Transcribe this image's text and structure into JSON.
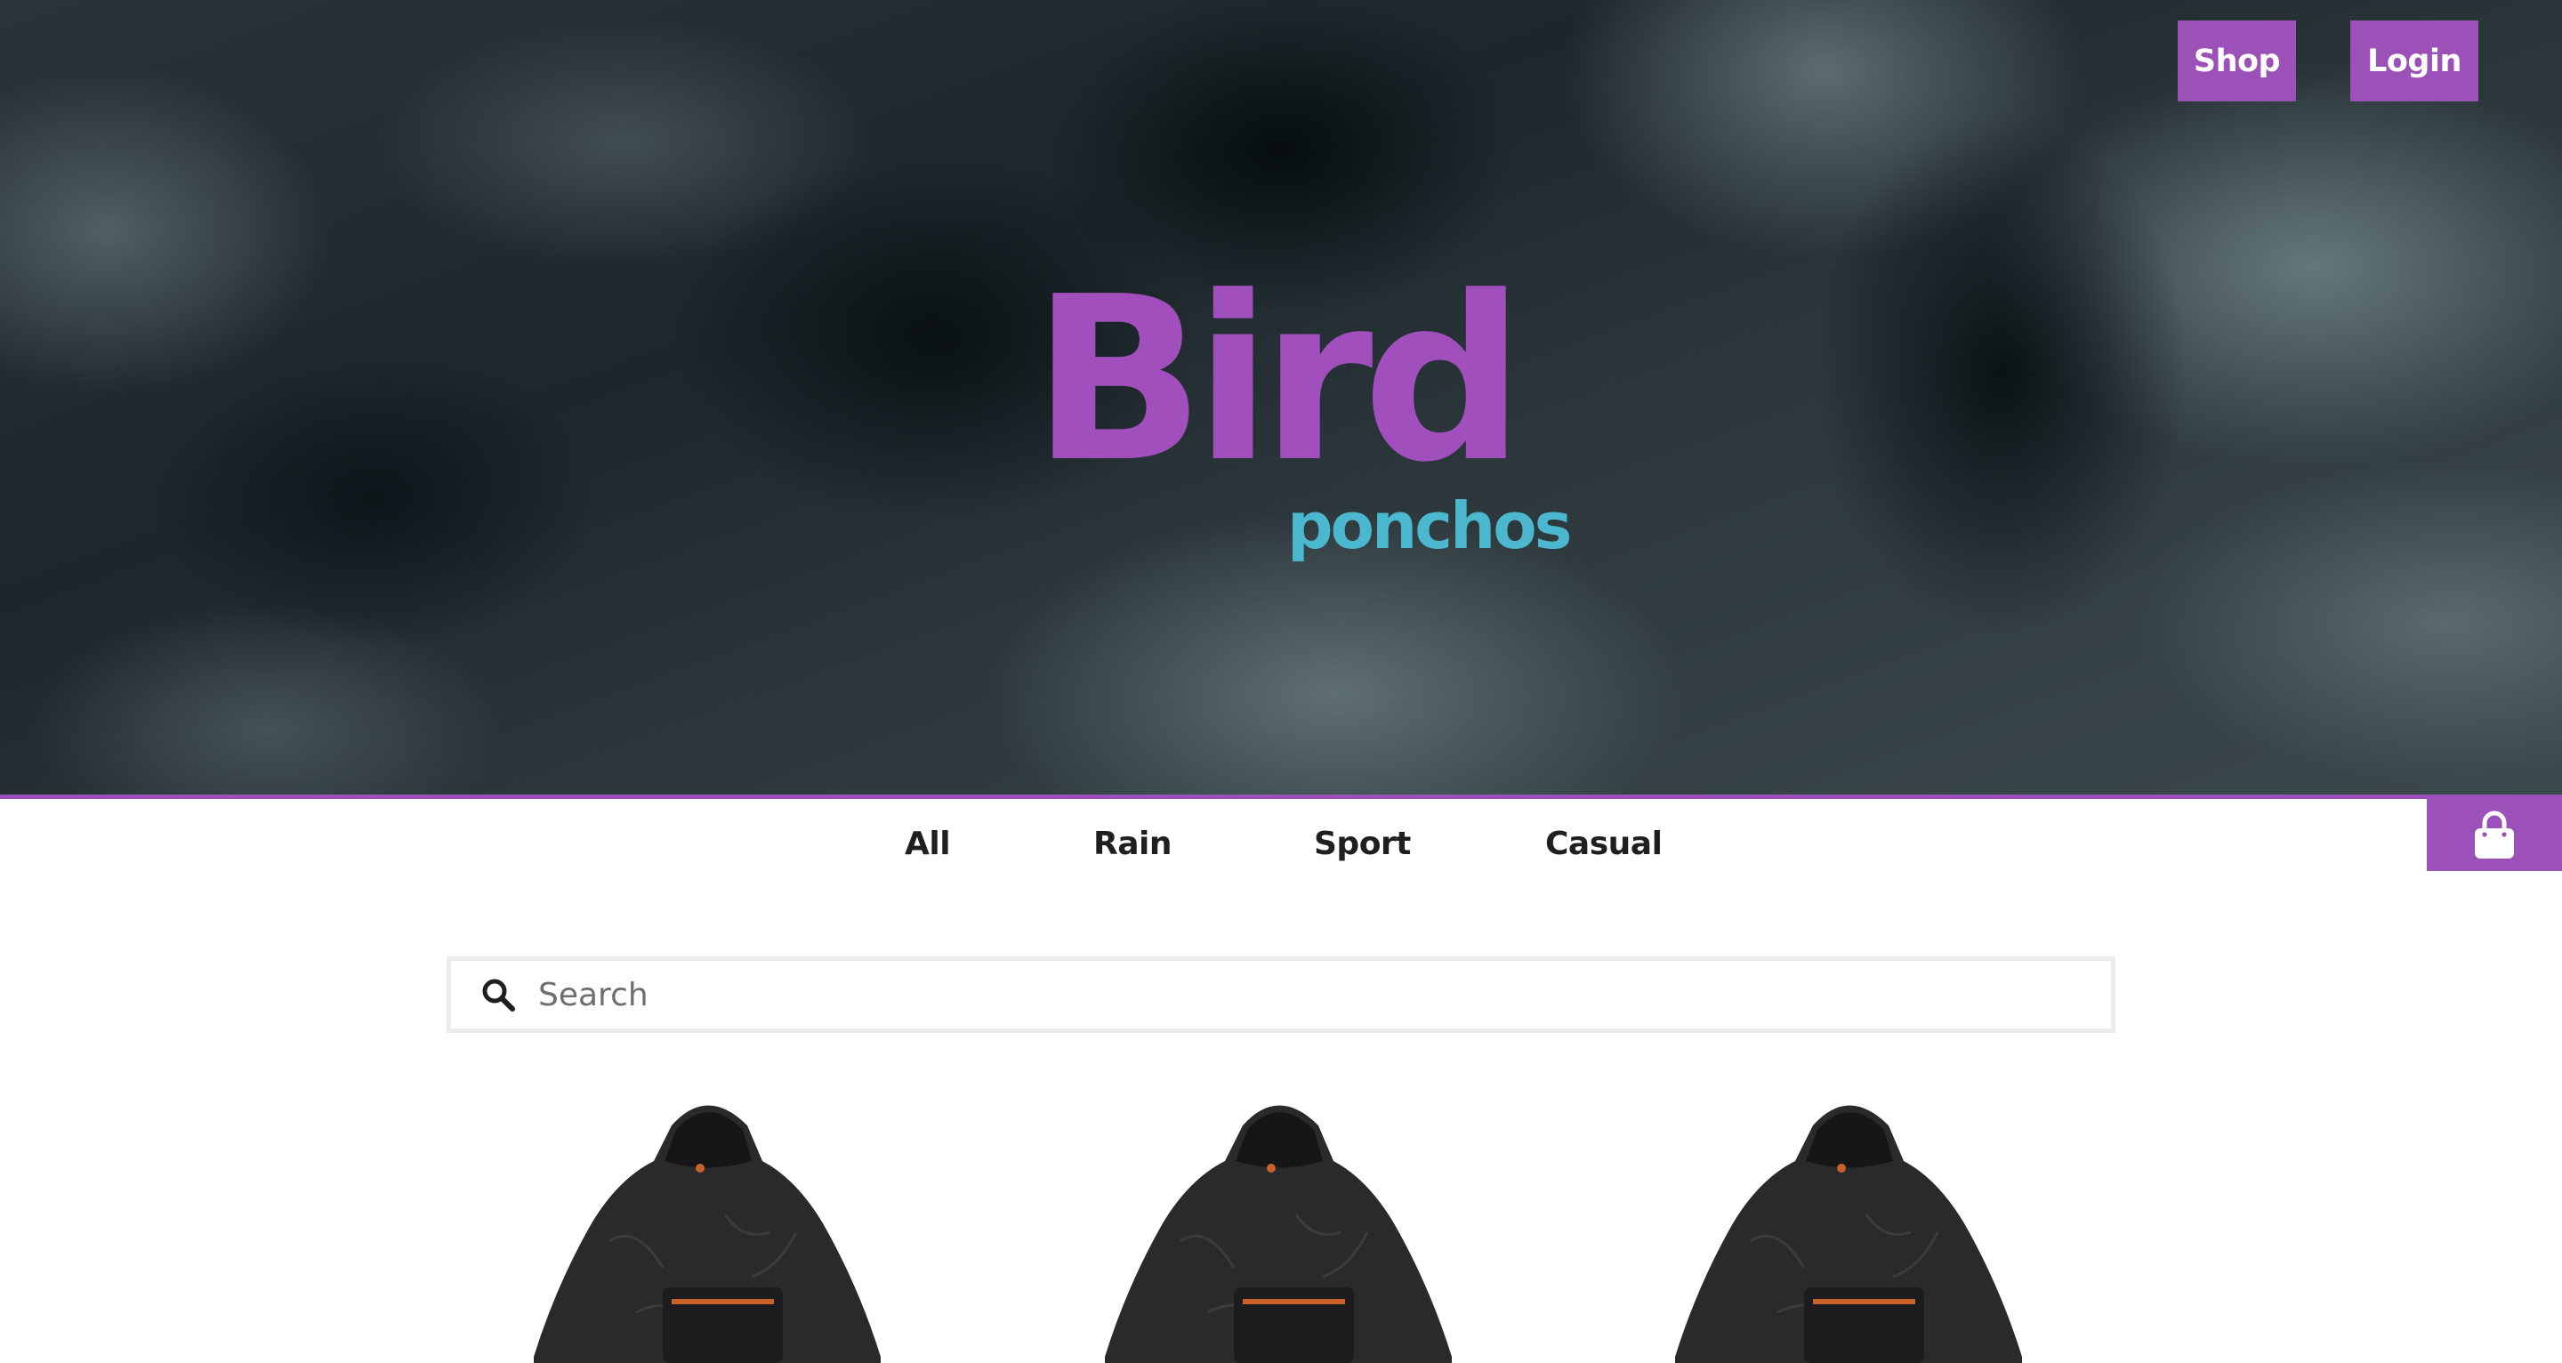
{
  "header": {
    "shop_label": "Shop",
    "login_label": "Login"
  },
  "brand": {
    "title": "Bird",
    "subtitle": "ponchos"
  },
  "categories": [
    {
      "label": "All"
    },
    {
      "label": "Rain"
    },
    {
      "label": "Sport"
    },
    {
      "label": "Casual"
    }
  ],
  "cart": {
    "icon": "shopping-bag-icon"
  },
  "search": {
    "placeholder": "Search",
    "value": "",
    "icon": "search-icon"
  },
  "products": [
    {
      "image": "black-poncho-image"
    },
    {
      "image": "black-poncho-image"
    },
    {
      "image": "black-poncho-image"
    }
  ],
  "colors": {
    "accent": "#9b51b7",
    "brand_title": "#a04fbd",
    "brand_subtitle": "#4bb8cf",
    "nav_text": "#1f1f1f",
    "search_border": "#ececec"
  }
}
